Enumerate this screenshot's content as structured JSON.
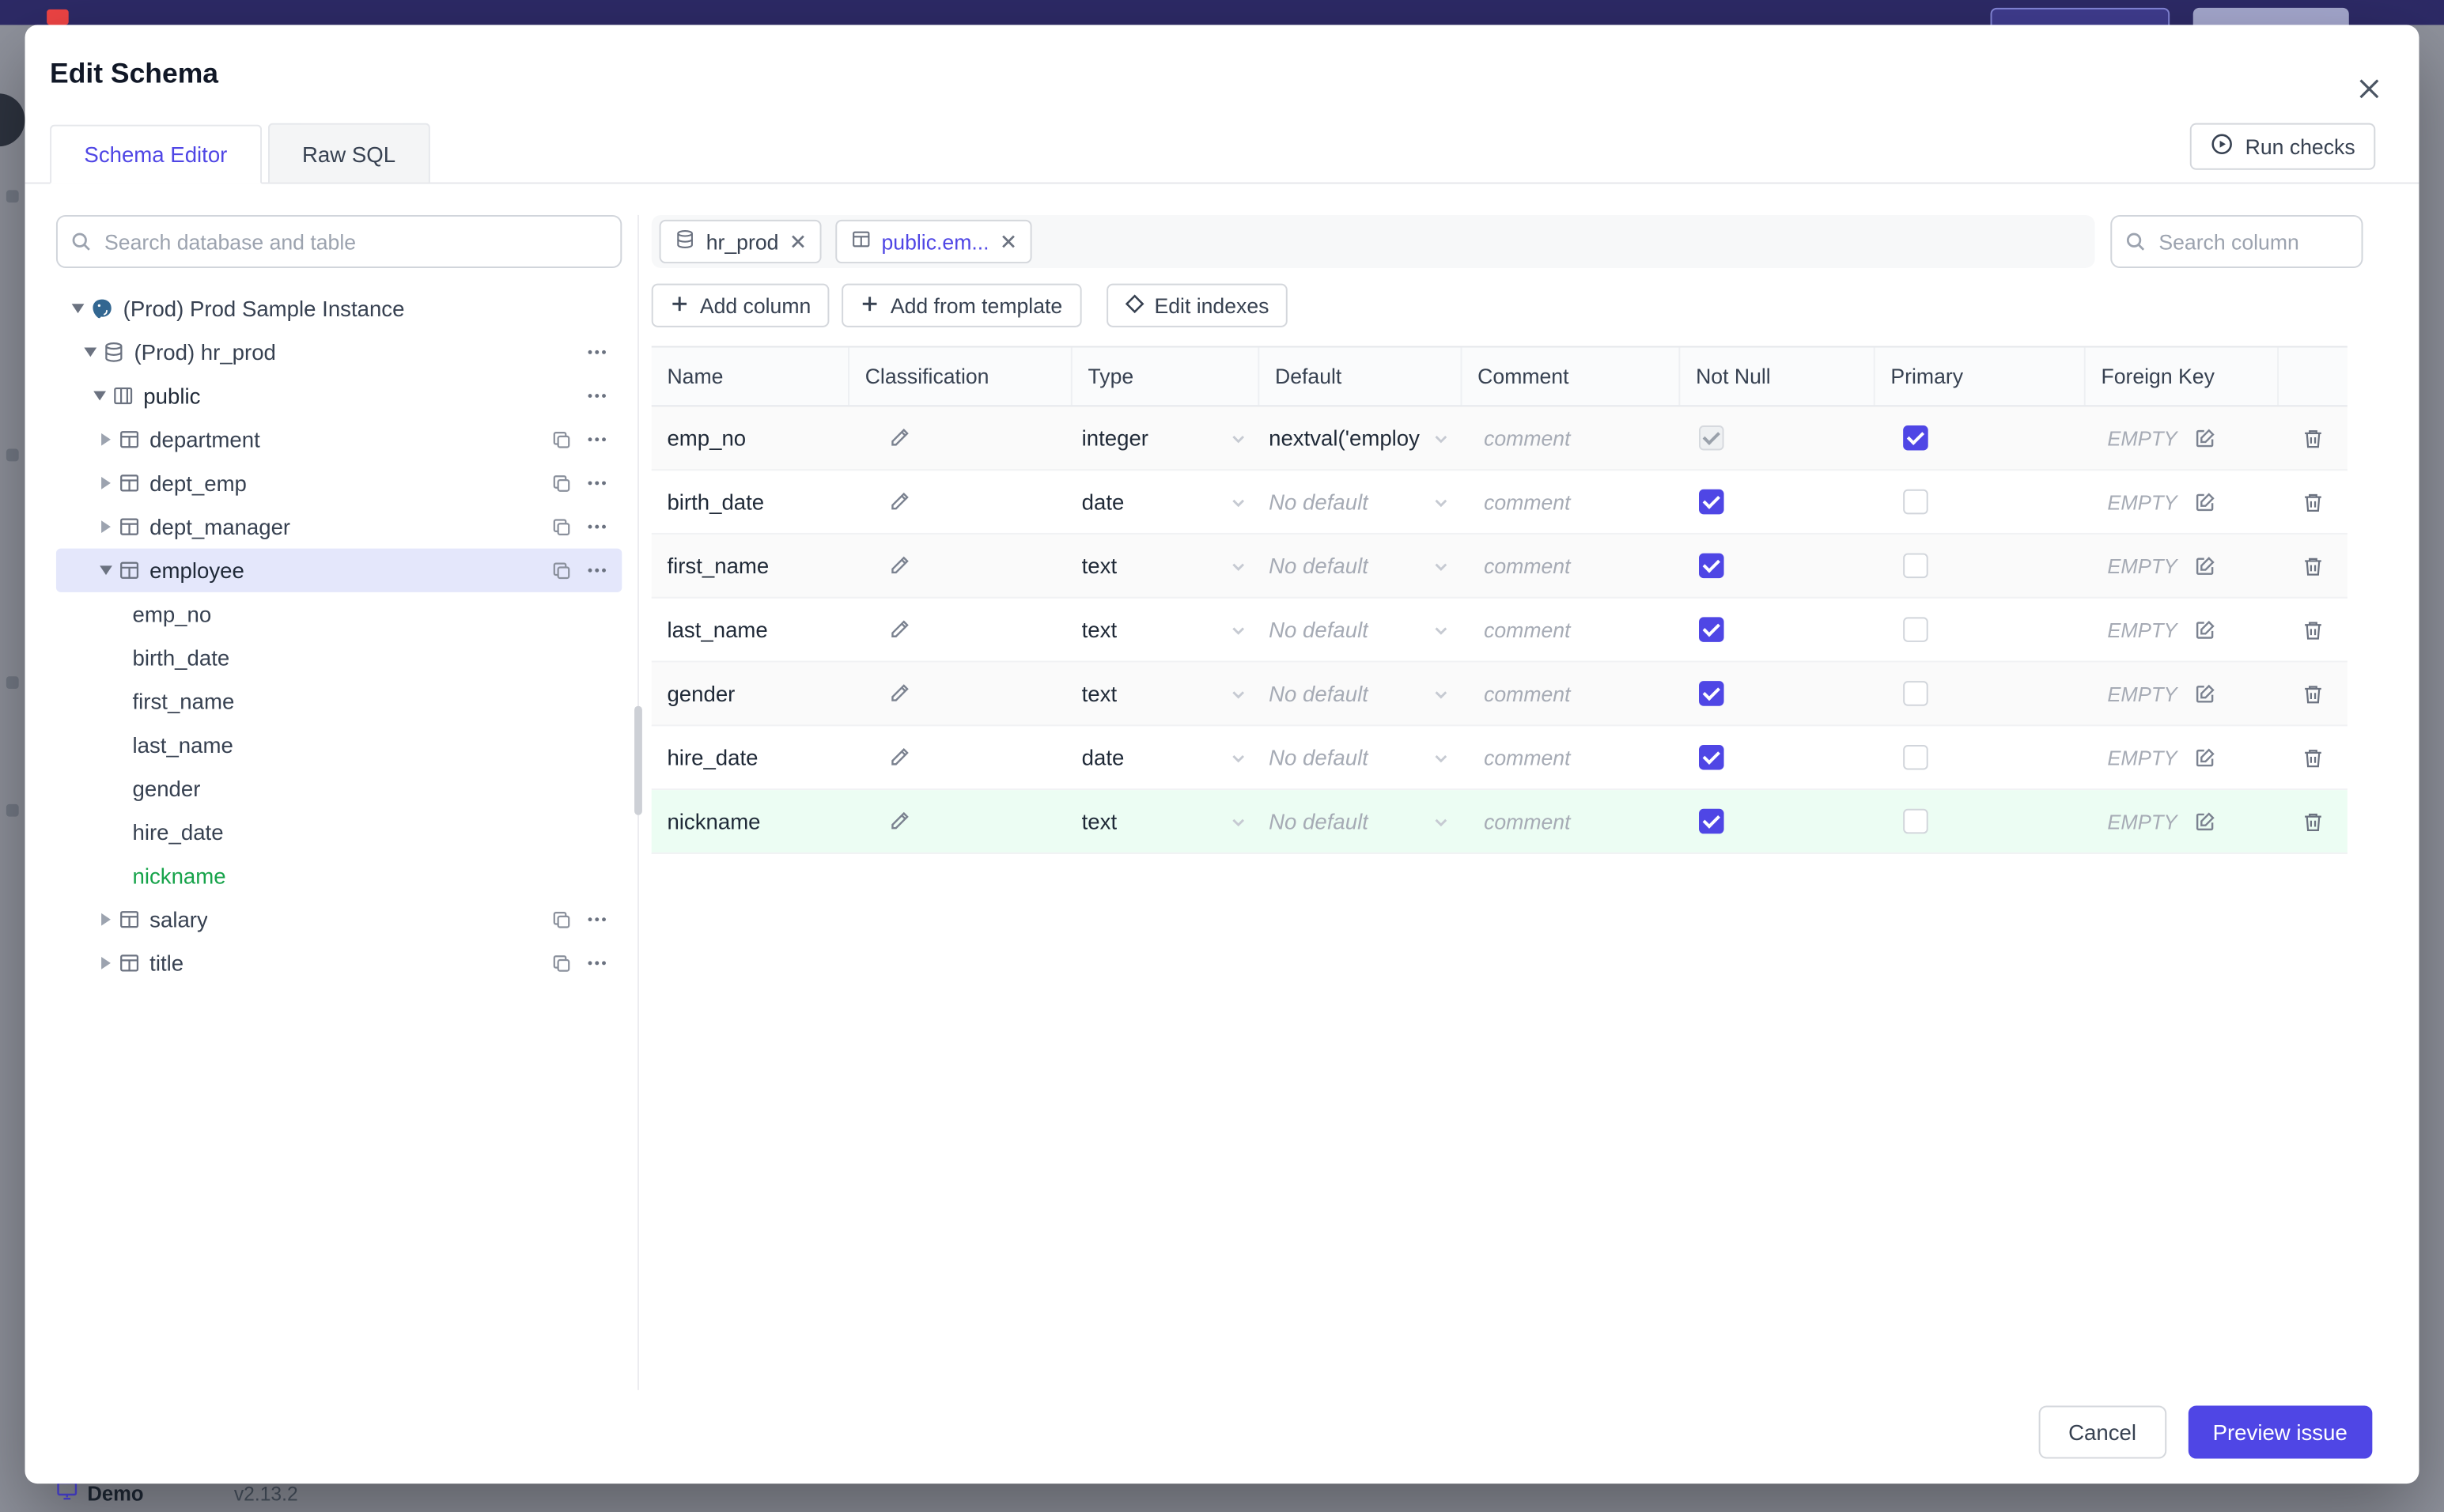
{
  "backdrop": {
    "demo": "Demo",
    "version": "v2.13.2"
  },
  "modal": {
    "title": "Edit Schema",
    "tabs": {
      "schema_editor": "Schema Editor",
      "raw_sql": "Raw SQL"
    },
    "run_checks": "Run checks",
    "sidebar": {
      "search_placeholder": "Search database and table",
      "instance_label": "(Prod) Prod Sample Instance",
      "database_label": "(Prod) hr_prod",
      "schema_label": "public",
      "tables": [
        "department",
        "dept_emp",
        "dept_manager",
        "employee",
        "salary",
        "title"
      ],
      "columns": [
        "emp_no",
        "birth_date",
        "first_name",
        "last_name",
        "gender",
        "hire_date",
        "nickname"
      ],
      "selected_table": "employee",
      "new_column": "nickname"
    },
    "editor": {
      "chips": [
        {
          "label": "hr_prod"
        },
        {
          "label": "public.em..."
        }
      ],
      "column_search_placeholder": "Search column",
      "toolbar": {
        "add_column": "Add column",
        "add_from_template": "Add from template",
        "edit_indexes": "Edit indexes"
      },
      "table": {
        "headers": [
          "Name",
          "Classification",
          "Type",
          "Default",
          "Comment",
          "Not Null",
          "Primary",
          "Foreign Key"
        ],
        "comment_placeholder": "comment",
        "fk_value": "EMPTY",
        "rows": [
          {
            "name": "emp_no",
            "type": "integer",
            "default": "nextval('employ",
            "has_default": true,
            "not_null": true,
            "not_null_disabled": true,
            "primary": true,
            "highlight": false
          },
          {
            "name": "birth_date",
            "type": "date",
            "default": "No default",
            "has_default": false,
            "not_null": true,
            "not_null_disabled": false,
            "primary": false,
            "highlight": false
          },
          {
            "name": "first_name",
            "type": "text",
            "default": "No default",
            "has_default": false,
            "not_null": true,
            "not_null_disabled": false,
            "primary": false,
            "highlight": false
          },
          {
            "name": "last_name",
            "type": "text",
            "default": "No default",
            "has_default": false,
            "not_null": true,
            "not_null_disabled": false,
            "primary": false,
            "highlight": false
          },
          {
            "name": "gender",
            "type": "text",
            "default": "No default",
            "has_default": false,
            "not_null": true,
            "not_null_disabled": false,
            "primary": false,
            "highlight": false
          },
          {
            "name": "hire_date",
            "type": "date",
            "default": "No default",
            "has_default": false,
            "not_null": true,
            "not_null_disabled": false,
            "primary": false,
            "highlight": false
          },
          {
            "name": "nickname",
            "type": "text",
            "default": "No default",
            "has_default": false,
            "not_null": true,
            "not_null_disabled": false,
            "primary": false,
            "highlight": true
          }
        ]
      }
    },
    "footer": {
      "cancel": "Cancel",
      "preview_issue": "Preview issue"
    }
  },
  "colors": {
    "accent": "#4f46e5",
    "new_column_green": "#16a34a",
    "new_row_bg": "#ecfdf3",
    "selected_tree_bg": "#e4e7fb"
  }
}
